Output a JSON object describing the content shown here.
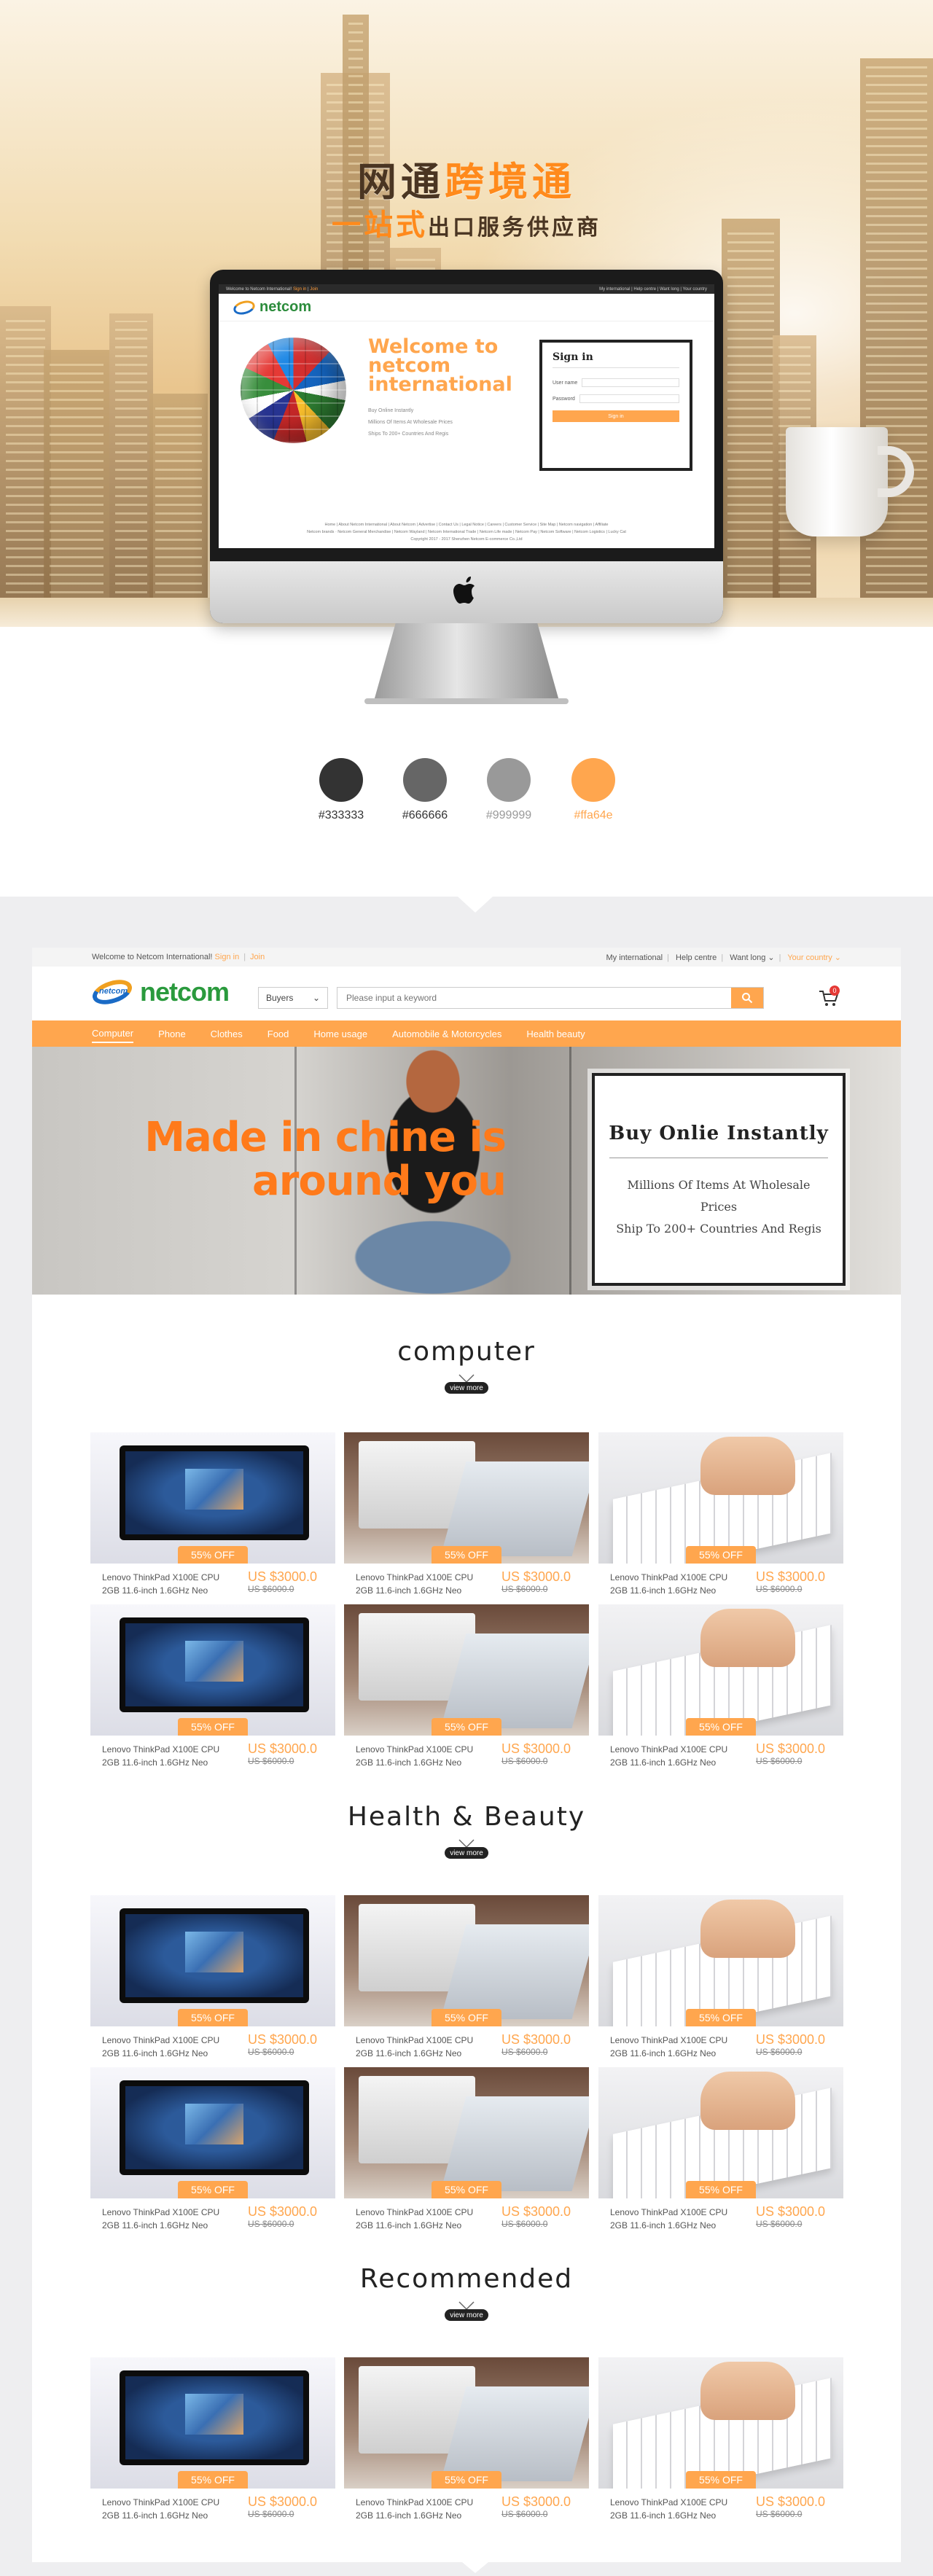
{
  "hero": {
    "title_a": "网通",
    "title_b": "跨境通",
    "sub_a": "一站式",
    "sub_b": "出口服务供应商"
  },
  "mini_site": {
    "topbar_left": "Welcome to Netcom International!",
    "topbar_signin": "Sign in",
    "topbar_join": "Join",
    "topbar_right": "My international | Help centre | Want long | Your country",
    "logo": "netcom",
    "welcome_lines": [
      "Welcome to",
      "netcom",
      "international"
    ],
    "bullets": [
      "Buy Online Instantly",
      "Millions Of Items At Wholesale Prices",
      "Ships To 200+ Countries And Regis"
    ],
    "signin_title": "Sign in",
    "user_label": "User name",
    "password_label": "Password",
    "signin_button": "Sign in",
    "footer_line1": "Home | About Netcom International | About Netcom | Advertise | Contact Us | Legal Notice | Careers | Customer Service | Site Map | Netcom navigation | Affiliate",
    "footer_line2": "Netcom brands · Netcom General Merchandise | Netcom Wayland | Netcom International Trade | Netcom Life made | Netcom Pay | Netcom Software | Netcom Logistics | Lucky Cat",
    "footer_line3": "Copyright 2017 - 2017 Shenzhen Netcom E-commerce Co.,Ltd"
  },
  "swatches": [
    {
      "hex": "#333333",
      "label": "#333333"
    },
    {
      "hex": "#666666",
      "label": "#666666"
    },
    {
      "hex": "#999999",
      "label": "#999999"
    },
    {
      "hex": "#ffa64e",
      "label": "#ffa64e"
    }
  ],
  "site": {
    "topbar": {
      "welcome": "Welcome to Netcom International!",
      "signin": "Sign in",
      "join": "Join",
      "my_international": "My international",
      "help": "Help centre",
      "want_long": "Want long",
      "country": "Your country"
    },
    "logo_mark": "netcom",
    "logo_text": "netcom",
    "buyers": "Buyers",
    "search_placeholder": "Please input a keyword",
    "cart_count": "0",
    "nav": [
      "Computer",
      "Phone",
      "Clothes",
      "Food",
      "Home usage",
      "Automobile & Motorcycles",
      "Health beauty"
    ],
    "banner": {
      "headline_1": "Made in chine is",
      "headline_2": "around you",
      "box_title": "Buy Onlie Instantly",
      "box_line_1": "Millions Of Items At Wholesale Prices",
      "box_line_2": "Ship To 200+ Countries And Regis"
    },
    "view_more": "view more",
    "sections": [
      "computer",
      "Health & Beauty",
      "Recommended"
    ],
    "product": {
      "badge": "55% OFF",
      "name_1": "Lenovo ThinkPad X100E CPU",
      "name_2": "2GB 11.6-inch 1.6GHz Neo",
      "price": "US $3000.0",
      "old_price": "US $6000.0"
    }
  },
  "colors": {
    "accent": "#ffa64e",
    "green": "#2a9a3d",
    "dark": "#222222"
  }
}
